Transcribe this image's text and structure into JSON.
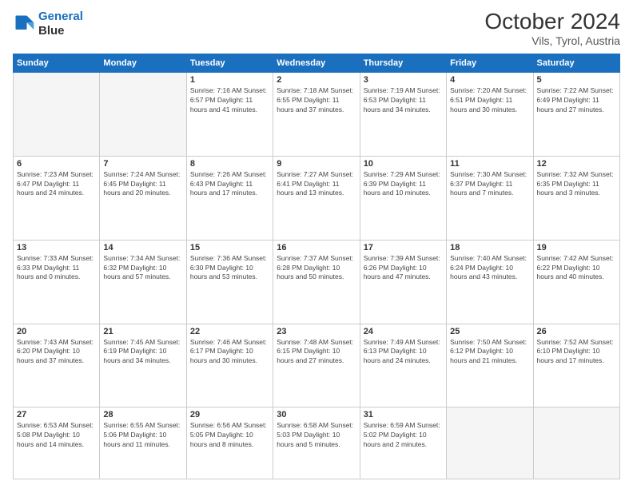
{
  "header": {
    "logo_line1": "General",
    "logo_line2": "Blue",
    "main_title": "October 2024",
    "sub_title": "Vils, Tyrol, Austria"
  },
  "days_of_week": [
    "Sunday",
    "Monday",
    "Tuesday",
    "Wednesday",
    "Thursday",
    "Friday",
    "Saturday"
  ],
  "weeks": [
    [
      {
        "day": "",
        "detail": ""
      },
      {
        "day": "",
        "detail": ""
      },
      {
        "day": "1",
        "detail": "Sunrise: 7:16 AM\nSunset: 6:57 PM\nDaylight: 11 hours and 41 minutes."
      },
      {
        "day": "2",
        "detail": "Sunrise: 7:18 AM\nSunset: 6:55 PM\nDaylight: 11 hours and 37 minutes."
      },
      {
        "day": "3",
        "detail": "Sunrise: 7:19 AM\nSunset: 6:53 PM\nDaylight: 11 hours and 34 minutes."
      },
      {
        "day": "4",
        "detail": "Sunrise: 7:20 AM\nSunset: 6:51 PM\nDaylight: 11 hours and 30 minutes."
      },
      {
        "day": "5",
        "detail": "Sunrise: 7:22 AM\nSunset: 6:49 PM\nDaylight: 11 hours and 27 minutes."
      }
    ],
    [
      {
        "day": "6",
        "detail": "Sunrise: 7:23 AM\nSunset: 6:47 PM\nDaylight: 11 hours and 24 minutes."
      },
      {
        "day": "7",
        "detail": "Sunrise: 7:24 AM\nSunset: 6:45 PM\nDaylight: 11 hours and 20 minutes."
      },
      {
        "day": "8",
        "detail": "Sunrise: 7:26 AM\nSunset: 6:43 PM\nDaylight: 11 hours and 17 minutes."
      },
      {
        "day": "9",
        "detail": "Sunrise: 7:27 AM\nSunset: 6:41 PM\nDaylight: 11 hours and 13 minutes."
      },
      {
        "day": "10",
        "detail": "Sunrise: 7:29 AM\nSunset: 6:39 PM\nDaylight: 11 hours and 10 minutes."
      },
      {
        "day": "11",
        "detail": "Sunrise: 7:30 AM\nSunset: 6:37 PM\nDaylight: 11 hours and 7 minutes."
      },
      {
        "day": "12",
        "detail": "Sunrise: 7:32 AM\nSunset: 6:35 PM\nDaylight: 11 hours and 3 minutes."
      }
    ],
    [
      {
        "day": "13",
        "detail": "Sunrise: 7:33 AM\nSunset: 6:33 PM\nDaylight: 11 hours and 0 minutes."
      },
      {
        "day": "14",
        "detail": "Sunrise: 7:34 AM\nSunset: 6:32 PM\nDaylight: 10 hours and 57 minutes."
      },
      {
        "day": "15",
        "detail": "Sunrise: 7:36 AM\nSunset: 6:30 PM\nDaylight: 10 hours and 53 minutes."
      },
      {
        "day": "16",
        "detail": "Sunrise: 7:37 AM\nSunset: 6:28 PM\nDaylight: 10 hours and 50 minutes."
      },
      {
        "day": "17",
        "detail": "Sunrise: 7:39 AM\nSunset: 6:26 PM\nDaylight: 10 hours and 47 minutes."
      },
      {
        "day": "18",
        "detail": "Sunrise: 7:40 AM\nSunset: 6:24 PM\nDaylight: 10 hours and 43 minutes."
      },
      {
        "day": "19",
        "detail": "Sunrise: 7:42 AM\nSunset: 6:22 PM\nDaylight: 10 hours and 40 minutes."
      }
    ],
    [
      {
        "day": "20",
        "detail": "Sunrise: 7:43 AM\nSunset: 6:20 PM\nDaylight: 10 hours and 37 minutes."
      },
      {
        "day": "21",
        "detail": "Sunrise: 7:45 AM\nSunset: 6:19 PM\nDaylight: 10 hours and 34 minutes."
      },
      {
        "day": "22",
        "detail": "Sunrise: 7:46 AM\nSunset: 6:17 PM\nDaylight: 10 hours and 30 minutes."
      },
      {
        "day": "23",
        "detail": "Sunrise: 7:48 AM\nSunset: 6:15 PM\nDaylight: 10 hours and 27 minutes."
      },
      {
        "day": "24",
        "detail": "Sunrise: 7:49 AM\nSunset: 6:13 PM\nDaylight: 10 hours and 24 minutes."
      },
      {
        "day": "25",
        "detail": "Sunrise: 7:50 AM\nSunset: 6:12 PM\nDaylight: 10 hours and 21 minutes."
      },
      {
        "day": "26",
        "detail": "Sunrise: 7:52 AM\nSunset: 6:10 PM\nDaylight: 10 hours and 17 minutes."
      }
    ],
    [
      {
        "day": "27",
        "detail": "Sunrise: 6:53 AM\nSunset: 5:08 PM\nDaylight: 10 hours and 14 minutes."
      },
      {
        "day": "28",
        "detail": "Sunrise: 6:55 AM\nSunset: 5:06 PM\nDaylight: 10 hours and 11 minutes."
      },
      {
        "day": "29",
        "detail": "Sunrise: 6:56 AM\nSunset: 5:05 PM\nDaylight: 10 hours and 8 minutes."
      },
      {
        "day": "30",
        "detail": "Sunrise: 6:58 AM\nSunset: 5:03 PM\nDaylight: 10 hours and 5 minutes."
      },
      {
        "day": "31",
        "detail": "Sunrise: 6:59 AM\nSunset: 5:02 PM\nDaylight: 10 hours and 2 minutes."
      },
      {
        "day": "",
        "detail": ""
      },
      {
        "day": "",
        "detail": ""
      }
    ]
  ]
}
